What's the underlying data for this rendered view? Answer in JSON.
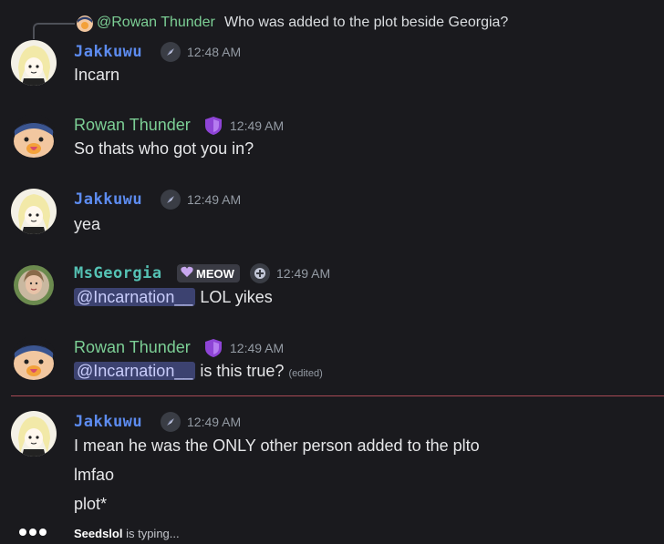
{
  "reply": {
    "name": "@Rowan Thunder",
    "text": "Who was added to the plot beside Georgia?"
  },
  "messages": [
    {
      "author": "Jakkuwu",
      "time": "12:48 AM",
      "lines": [
        "Incarn"
      ]
    },
    {
      "author": "Rowan Thunder",
      "time": "12:49 AM",
      "lines": [
        "So thats who got you in?"
      ]
    },
    {
      "author": "Jakkuwu",
      "time": "12:49 AM",
      "lines": [
        "yea"
      ]
    },
    {
      "author": "MsGeorgia",
      "tag": "MEOW",
      "time": "12:49 AM",
      "mention": "@Incarnation__",
      "text": "LOL yikes"
    },
    {
      "author": "Rowan Thunder",
      "time": "12:49 AM",
      "mention": "@Incarnation__",
      "text": "is this true?",
      "edited": "(edited)"
    },
    {
      "author": "Jakkuwu",
      "time": "12:49 AM",
      "lines": [
        "I mean he was the ONLY other person added to the plto",
        "lmfao",
        "plot*"
      ]
    }
  ],
  "typing": {
    "user": "Seedslol",
    "text": "is typing..."
  },
  "icons": {
    "jak_badge": "compass-icon",
    "rowan_badge": "shield-icon",
    "ms_badge": "plus-circle-icon",
    "meow_heart": "heart-icon"
  },
  "colors": {
    "background": "#1a1a1e",
    "jak_name": "#5d8cf0",
    "rowan_name": "#7ccf95",
    "ms_name": "#55c2b4",
    "mention_bg": "#3c4270",
    "new_divider": "#a64a54"
  }
}
